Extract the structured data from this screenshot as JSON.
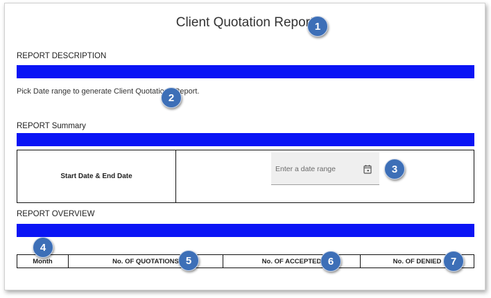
{
  "page": {
    "title": "Client Quotation Report"
  },
  "description_section": {
    "label": "REPORT DESCRIPTION",
    "text": "Pick Date range to generate Client Quotations Report."
  },
  "summary_section": {
    "label": "REPORT Summary",
    "row_label": "Start Date & End Date",
    "date_range_placeholder": "Enter a date range",
    "date_icon": "calendar-icon"
  },
  "overview_section": {
    "label": "REPORT OVERVIEW",
    "columns": [
      "Month",
      "No. OF QUOTATIONS",
      "No. OF ACCEPTED",
      "No. OF DENIED"
    ]
  },
  "badges": [
    "1",
    "2",
    "3",
    "4",
    "5",
    "6",
    "7"
  ],
  "colors": {
    "section_bar": "#0a14f5",
    "badge": "#3d6fb7"
  }
}
